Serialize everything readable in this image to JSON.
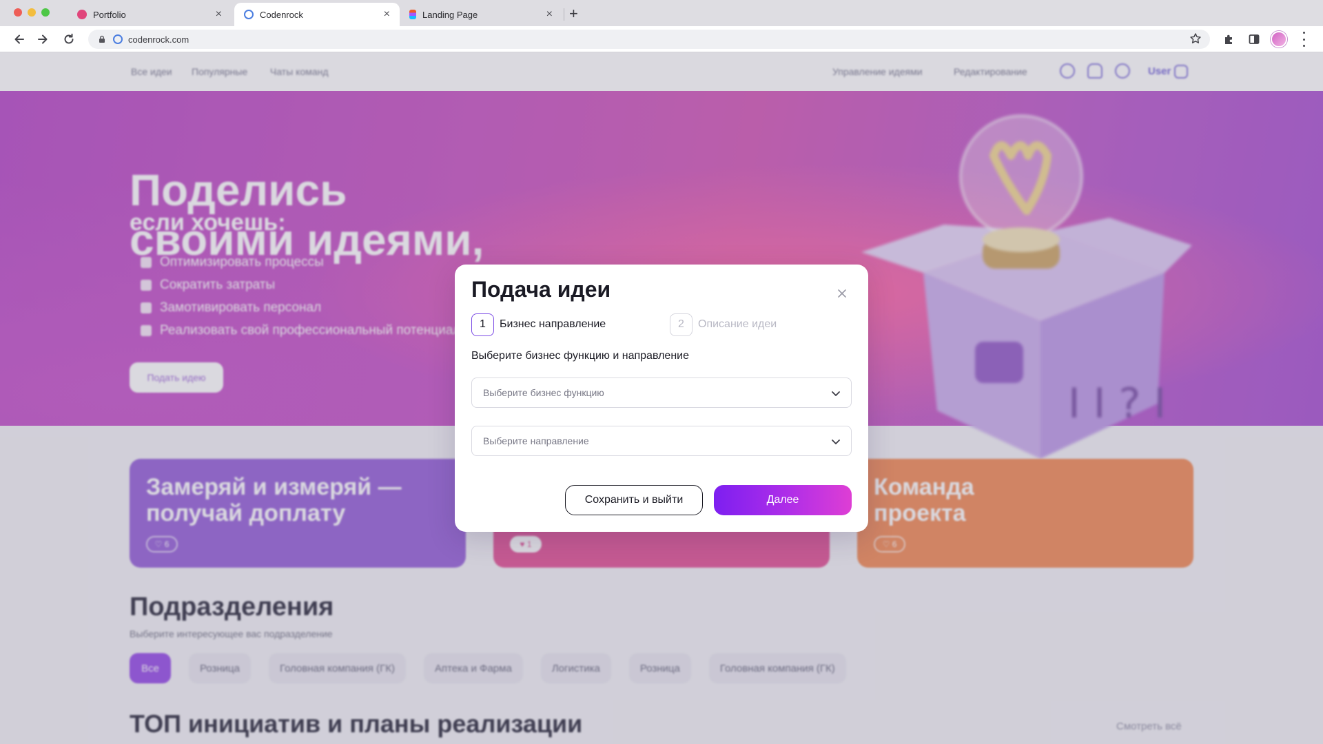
{
  "browser": {
    "tabs": [
      {
        "title": "Portfolio",
        "favicon_color": "#e0457b"
      },
      {
        "title": "Codenrock",
        "favicon_color": "#4a7de0"
      },
      {
        "title": "Landing Page",
        "favicon_color": "#f05a28"
      }
    ],
    "active_tab": 1,
    "url": "codenrock.com",
    "icons": [
      "back-icon",
      "forward-icon",
      "reload-icon",
      "lock-icon",
      "star-icon",
      "extensions-icon",
      "sidepanel-icon",
      "profile-avatar",
      "menu-icon"
    ]
  },
  "site": {
    "nav_left": [
      "Все идеи",
      "Популярные",
      "Чаты команд"
    ],
    "nav_right": [
      "Управление идеями",
      "Редактирование"
    ],
    "user_label": "User",
    "hero": {
      "title_line1": "Поделись",
      "title_line2": "своими идеями,",
      "subtitle": "если хочешь:",
      "bullets": [
        "Оптимизировать процессы",
        "Сократить затраты",
        "Замотивировать персонал",
        "Реализовать свой профессиональный потенциал"
      ],
      "button": "Подать идею"
    },
    "promos": [
      {
        "line1": "Замеряй и измеряй —",
        "line2": "получай доплату",
        "likes": "6",
        "color": "#8e55d6"
      },
      {
        "line1": "",
        "line2": "",
        "likes": "1",
        "color": "#e0458e"
      },
      {
        "line1": "Команда",
        "line2": "проекта",
        "likes": "6",
        "color": "#f0824a"
      }
    ],
    "departments": {
      "title": "Подразделения",
      "subtitle": "Выберите интересующее вас подразделение",
      "chips": [
        "Все",
        "Розница",
        "Головная компания (ГК)",
        "Аптека и Фарма",
        "Логистика",
        "Розница",
        "Головная компания (ГК)"
      ]
    },
    "top": {
      "title": "ТОП инициатив и планы реализации",
      "see_all": "Смотреть всё"
    }
  },
  "modal": {
    "title": "Подача идеи",
    "steps": [
      {
        "num": "1",
        "label": "Бизнес направление",
        "active": true
      },
      {
        "num": "2",
        "label": "Описание идеи",
        "active": false
      }
    ],
    "subtitle": "Выберите бизнес функцию и направление",
    "select_function_placeholder": "Выберите бизнес функцию",
    "select_direction_placeholder": "Выберите направление",
    "save_button": "Сохранить и выйти",
    "next_button": "Далее",
    "accent_color": "#8e2bef"
  }
}
